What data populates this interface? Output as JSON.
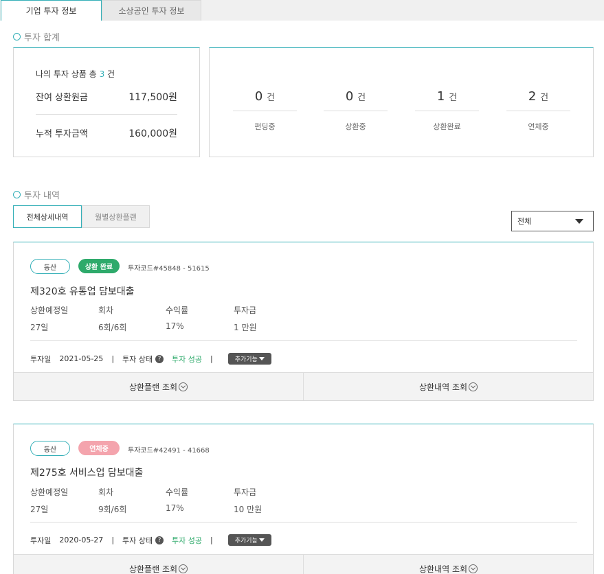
{
  "tabs": {
    "corporate": "기업 투자 정보",
    "small_business": "소상공인 투자 정보"
  },
  "summary": {
    "title": "투자 합계",
    "products_prefix": "나의 투자 상품 총",
    "products_count": "3",
    "products_suffix": "건",
    "remaining_label": "잔여 상환원금",
    "remaining_value": "117,500원",
    "cumulative_label": "누적 투자금액",
    "cumulative_value": "160,000원",
    "stats": [
      {
        "num": "0",
        "unit": "건",
        "label": "펀딩중"
      },
      {
        "num": "0",
        "unit": "건",
        "label": "상환중"
      },
      {
        "num": "1",
        "unit": "건",
        "label": "상환완료"
      },
      {
        "num": "2",
        "unit": "건",
        "label": "연체중"
      }
    ]
  },
  "history": {
    "title": "투자 내역",
    "tab_all": "전체상세내역",
    "tab_monthly": "월별상환플랜",
    "filter_value": "전체"
  },
  "colors": {
    "accent": "#35b0b8",
    "complete": "#2eaa6b",
    "overdue": "#f4a4ad"
  },
  "cards": [
    {
      "type_badge": "동산",
      "status_badge": "상환 완료",
      "code": "투자코드#45848 - 51615",
      "title": "제320호 유통업 담보대출",
      "col_labels": [
        "상환예정일",
        "회차",
        "수익률",
        "투자금"
      ],
      "col_values": [
        "27일",
        "6회/6회",
        "17%",
        "1 만원"
      ],
      "date_label": "투자일",
      "date_value": "2021-05-25",
      "state_label": "투자 상태",
      "state_value": "투자 성공",
      "extra_button": "추가기능",
      "plan_button": "상환플랜 조회",
      "history_button": "상환내역 조회"
    },
    {
      "type_badge": "동산",
      "status_badge": "연체중",
      "code": "투자코드#42491 - 41668",
      "title": "제275호 서비스업 담보대출",
      "col_labels": [
        "상환예정일",
        "회차",
        "수익률",
        "투자금"
      ],
      "col_values": [
        "27일",
        "9회/6회",
        "17%",
        "10 만원"
      ],
      "date_label": "투자일",
      "date_value": "2020-05-27",
      "state_label": "투자 상태",
      "state_value": "투자 성공",
      "extra_button": "추가기능",
      "plan_button": "상환플랜 조회",
      "history_button": "상환내역 조회"
    }
  ]
}
